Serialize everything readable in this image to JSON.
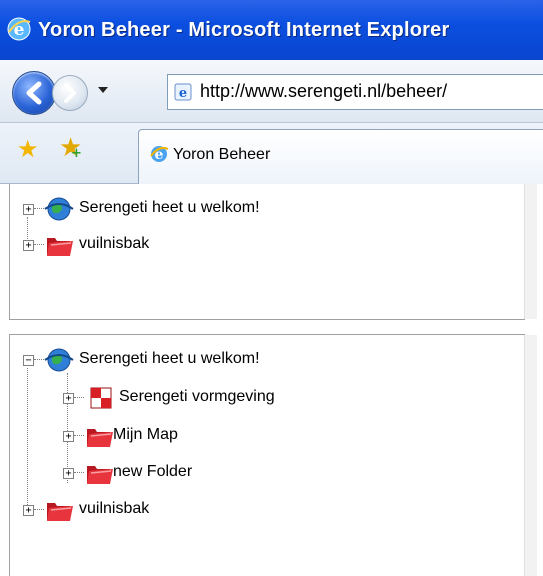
{
  "window": {
    "title": "Yoron Beheer - Microsoft Internet Explorer"
  },
  "address_bar": {
    "url": "http://www.serengeti.nl/beheer/"
  },
  "tab": {
    "label": "Yoron Beheer"
  },
  "tree_collapsed": {
    "nodes": [
      {
        "label": "Serengeti heet u welkom!",
        "icon": "globe-icon",
        "expander": "+"
      },
      {
        "label": "vuilnisbak",
        "icon": "folder-icon",
        "expander": "+"
      }
    ]
  },
  "tree_expanded": {
    "root": {
      "label": "Serengeti heet u welkom!",
      "icon": "globe-icon",
      "expander": "−"
    },
    "children": [
      {
        "label": "Serengeti vormgeving",
        "icon": "checkered-flag-icon",
        "expander": "+"
      },
      {
        "label": "Mijn Map",
        "icon": "folder-icon",
        "expander": "+"
      },
      {
        "label": "new Folder",
        "icon": "folder-icon",
        "expander": "+"
      }
    ],
    "sibling": {
      "label": "vuilnisbak",
      "icon": "folder-icon",
      "expander": "+"
    }
  },
  "colors": {
    "titlebar": "#0b4fe0",
    "folder": "#e8343c",
    "globe": "#2f7fd8"
  }
}
